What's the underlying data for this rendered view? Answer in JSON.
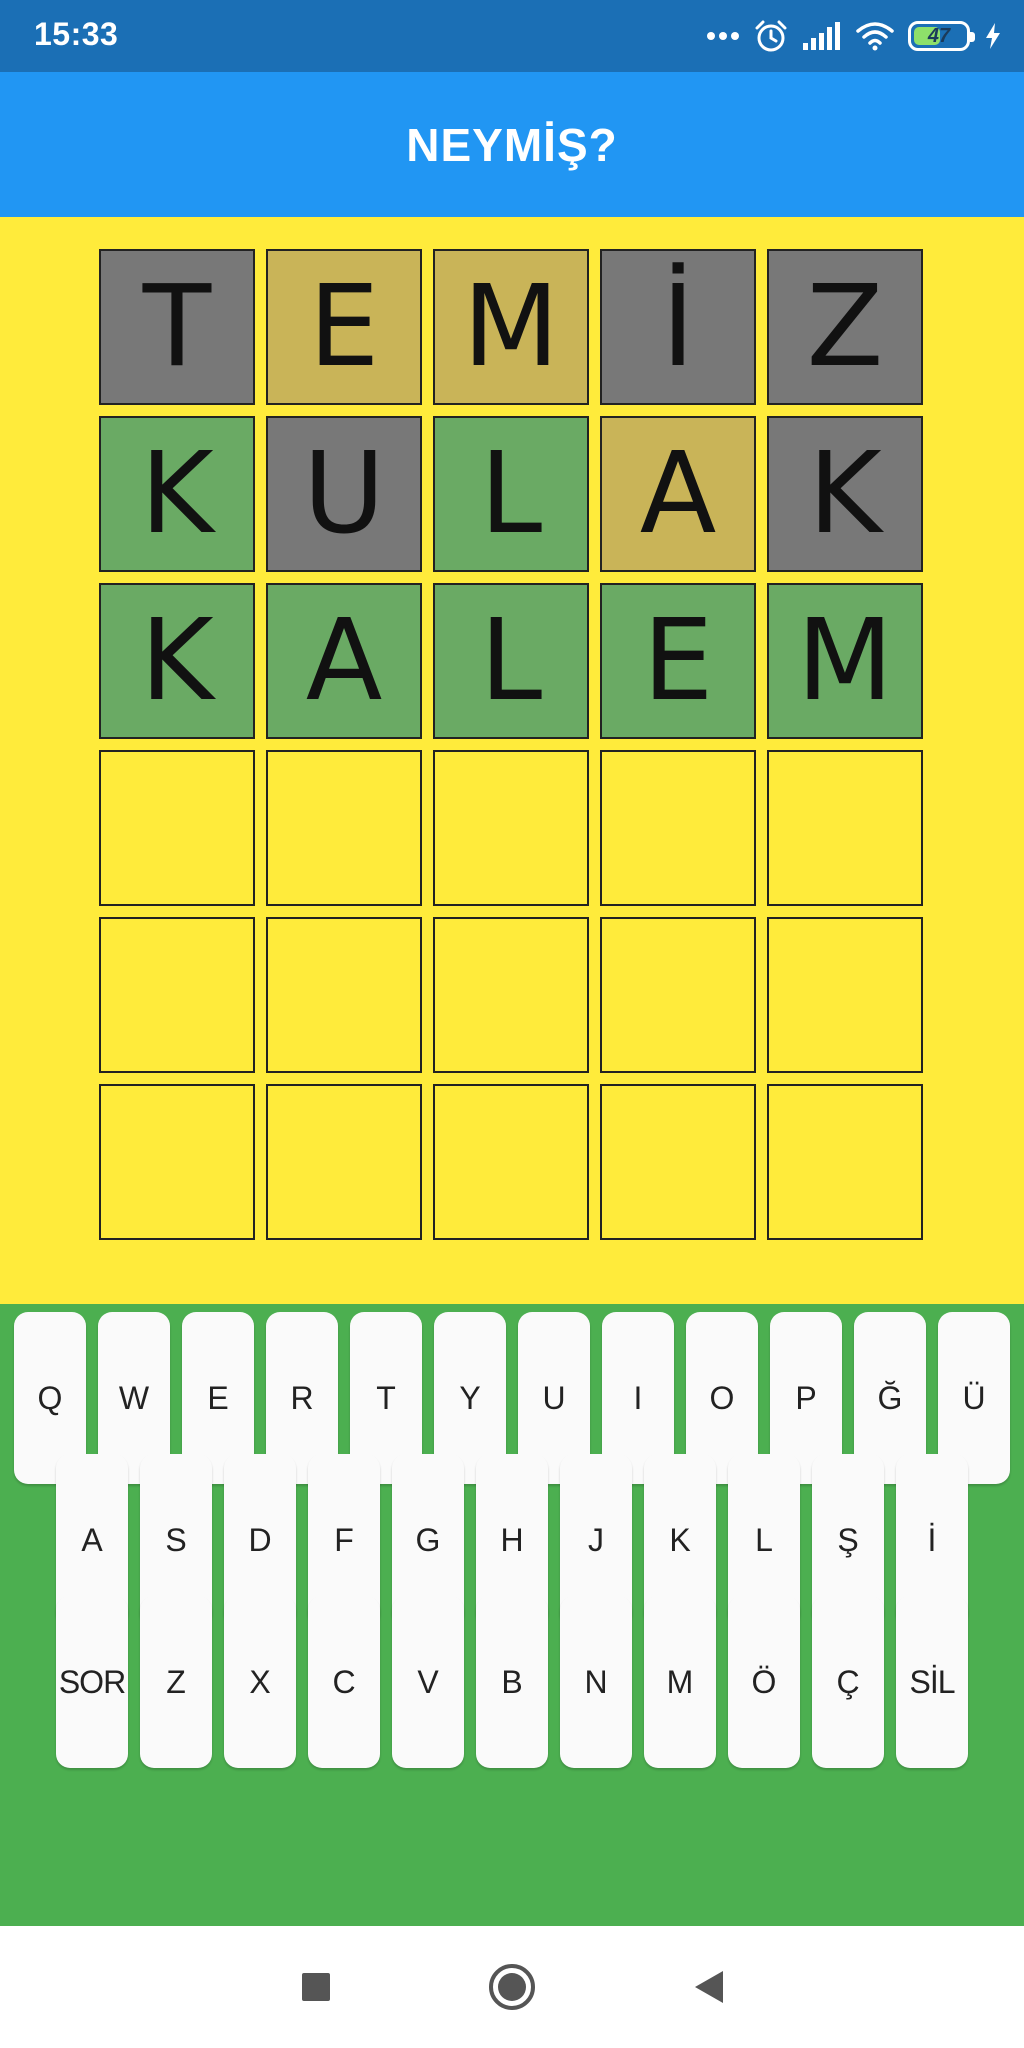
{
  "status_bar": {
    "time": "15:33",
    "battery": "47"
  },
  "app": {
    "title": "NEYMİŞ?"
  },
  "board": {
    "rows": [
      [
        {
          "letter": "T",
          "state": "gray"
        },
        {
          "letter": "E",
          "state": "yellow"
        },
        {
          "letter": "M",
          "state": "yellow"
        },
        {
          "letter": "İ",
          "state": "gray"
        },
        {
          "letter": "Z",
          "state": "gray"
        }
      ],
      [
        {
          "letter": "K",
          "state": "green"
        },
        {
          "letter": "U",
          "state": "gray"
        },
        {
          "letter": "L",
          "state": "green"
        },
        {
          "letter": "A",
          "state": "yellow"
        },
        {
          "letter": "K",
          "state": "gray"
        }
      ],
      [
        {
          "letter": "K",
          "state": "green"
        },
        {
          "letter": "A",
          "state": "green"
        },
        {
          "letter": "L",
          "state": "green"
        },
        {
          "letter": "E",
          "state": "green"
        },
        {
          "letter": "M",
          "state": "green"
        }
      ],
      [
        {
          "letter": "",
          "state": "empty"
        },
        {
          "letter": "",
          "state": "empty"
        },
        {
          "letter": "",
          "state": "empty"
        },
        {
          "letter": "",
          "state": "empty"
        },
        {
          "letter": "",
          "state": "empty"
        }
      ],
      [
        {
          "letter": "",
          "state": "empty"
        },
        {
          "letter": "",
          "state": "empty"
        },
        {
          "letter": "",
          "state": "empty"
        },
        {
          "letter": "",
          "state": "empty"
        },
        {
          "letter": "",
          "state": "empty"
        }
      ],
      [
        {
          "letter": "",
          "state": "empty"
        },
        {
          "letter": "",
          "state": "empty"
        },
        {
          "letter": "",
          "state": "empty"
        },
        {
          "letter": "",
          "state": "empty"
        },
        {
          "letter": "",
          "state": "empty"
        }
      ]
    ]
  },
  "keyboard": {
    "rows": [
      [
        "Q",
        "W",
        "E",
        "R",
        "T",
        "Y",
        "U",
        "I",
        "O",
        "P",
        "Ğ",
        "Ü"
      ],
      [
        "A",
        "S",
        "D",
        "F",
        "G",
        "H",
        "J",
        "K",
        "L",
        "Ş",
        "İ"
      ],
      [
        "SOR",
        "Z",
        "X",
        "C",
        "V",
        "B",
        "N",
        "M",
        "Ö",
        "Ç",
        "SİL"
      ]
    ]
  },
  "nav": {
    "icons": [
      "recents-square-icon",
      "home-circle-icon",
      "back-triangle-icon"
    ]
  },
  "colors": {
    "status_bar": "#1b6fb5",
    "app_bar": "#2196f3",
    "board_bg": "#ffeb3b",
    "keyboard_bg": "#4caf50",
    "tile_gray": "#787878",
    "tile_yellow": "#c9b458",
    "tile_green": "#6aaa64",
    "key_bg": "#fafafa"
  }
}
